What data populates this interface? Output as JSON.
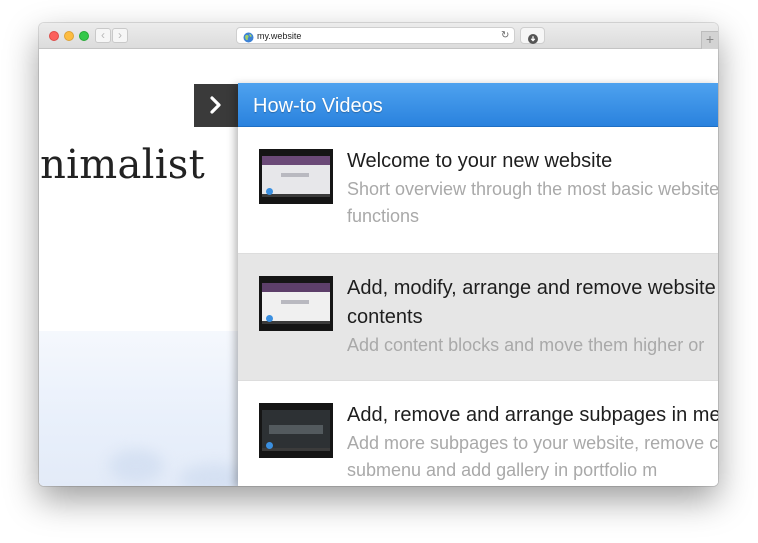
{
  "browser": {
    "url": "my.website",
    "back_glyph": "‹",
    "forward_glyph": "›",
    "reload_glyph": "↻",
    "new_tab_glyph": "+",
    "icons": [
      "globe-icon",
      "reload-icon",
      "download-icon"
    ]
  },
  "site": {
    "title": "inimalist"
  },
  "panel": {
    "title": "How-to Videos",
    "toggle_icon": "chevron-right-icon",
    "accent_color": "#3b92e8",
    "videos": [
      {
        "title": "Welcome to your new website",
        "description": "Short overview through the most basic website functions"
      },
      {
        "title": "Add, modify, arrange and remove website contents",
        "description": "Add content blocks and move them higher or"
      },
      {
        "title": "Add, remove and arrange subpages in menu",
        "description": "Add more subpages to your website, remove create submenu and add gallery in portfolio m"
      }
    ]
  }
}
